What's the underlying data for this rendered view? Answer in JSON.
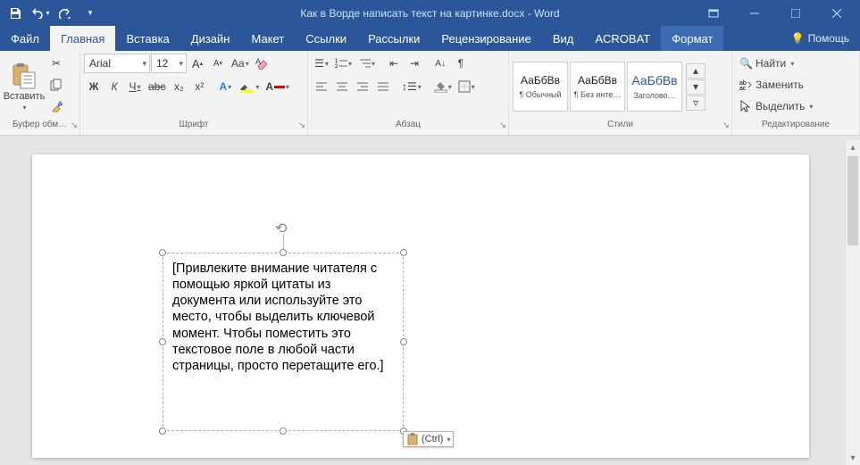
{
  "titlebar": {
    "title": "Как в Ворде написать текст на картинке.docx - Word"
  },
  "tabs": {
    "file": "Файл",
    "home": "Главная",
    "insert": "Вставка",
    "design": "Дизайн",
    "layout": "Макет",
    "references": "Ссылки",
    "mailings": "Рассылки",
    "review": "Рецензирование",
    "view": "Вид",
    "acrobat": "ACROBAT",
    "format": "Формат",
    "help": "Помощь"
  },
  "ribbon": {
    "clipboard": {
      "label": "Буфер обм…",
      "paste": "Вставить"
    },
    "font": {
      "label": "Шрифт",
      "name": "Arial",
      "size": "12",
      "bold": "Ж",
      "italic": "К",
      "underline": "Ч",
      "strike": "abc",
      "sub": "x₂",
      "sup": "x²",
      "grow": "A",
      "shrink": "A",
      "case": "Aa"
    },
    "paragraph": {
      "label": "Абзац"
    },
    "styles": {
      "label": "Стили",
      "sample": "АаБбВв",
      "sample_h": "АаБбВв",
      "s1": "¶ Обычный",
      "s2": "¶ Без инте…",
      "s3": "Заголово…"
    },
    "editing": {
      "label": "Редактирование",
      "find": "Найти",
      "replace": "Заменить",
      "select": "Выделить"
    }
  },
  "document": {
    "textbox": "[Привлеките внимание читателя с помощью яркой цитаты из документа или используйте это место, чтобы выделить ключевой момент. Чтобы поместить это текстовое поле в любой части страницы, просто перетащите его.]",
    "paste_options": "(Ctrl)"
  }
}
